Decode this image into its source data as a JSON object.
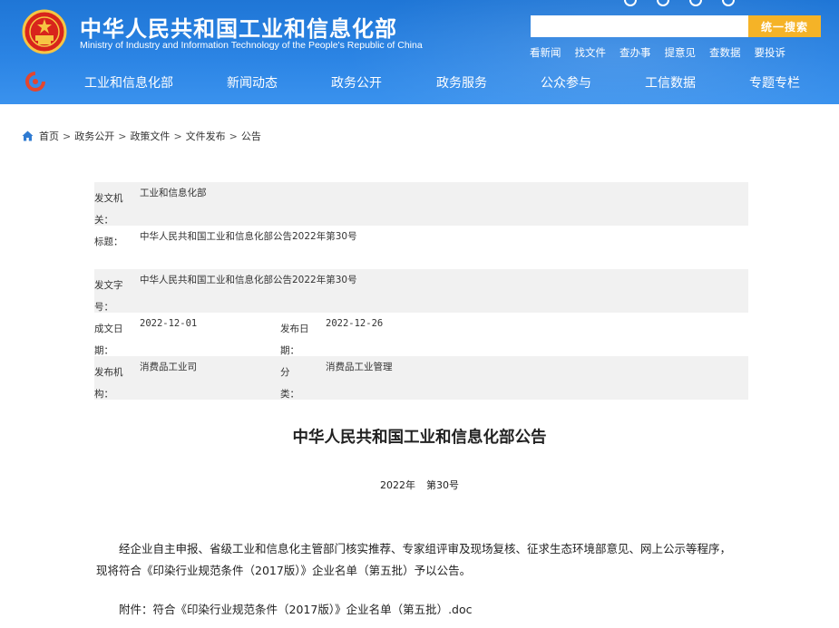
{
  "header": {
    "site_name_cn": "中华人民共和国工业和信息化部",
    "site_name_en": "Ministry of Industry and Information Technology of the People's Republic of China",
    "search_placeholder": "",
    "search_button": "统一搜索",
    "quick_links": [
      "看新闻",
      "找文件",
      "查办事",
      "提意见",
      "查数据",
      "要投诉"
    ]
  },
  "nav": {
    "items": [
      "工业和信息化部",
      "新闻动态",
      "政务公开",
      "政务服务",
      "公众参与",
      "工信数据",
      "专题专栏"
    ]
  },
  "breadcrumb": [
    "首页",
    "政务公开",
    "政策文件",
    "文件发布",
    "公告"
  ],
  "meta": {
    "issuer_label": "发文机关：",
    "issuer": "工业和信息化部",
    "title_label": "标题：",
    "title": "中华人民共和国工业和信息化部公告2022年第30号",
    "doc_no_label": "发文字号：",
    "doc_no": "中华人民共和国工业和信息化部公告2022年第30号",
    "written_date_label": "成文日期：",
    "written_date": "2022-12-01",
    "publish_date_label": "发布日期：",
    "publish_date": "2022-12-26",
    "publisher_label": "发布机构：",
    "publisher": "消费品工业司",
    "category_label": "分类：",
    "category": "消费品工业管理"
  },
  "article": {
    "title": "中华人民共和国工业和信息化部公告",
    "year": "2022年",
    "number": "第30号",
    "body": "经企业自主申报、省级工业和信息化主管部门核实推荐、专家组评审及现场复核、征求生态环境部意见、网上公示等程序，现将符合《印染行业规范条件（2017版）》企业名单（第五批）予以公告。",
    "attachment_label": "附件：",
    "attachment_name": "符合《印染行业规范条件（2017版）》企业名单（第五批）.doc"
  },
  "colors": {
    "header_blue": "#2b84e4",
    "search_button": "#f5b327",
    "meta_shade": "#f1f1f1"
  }
}
